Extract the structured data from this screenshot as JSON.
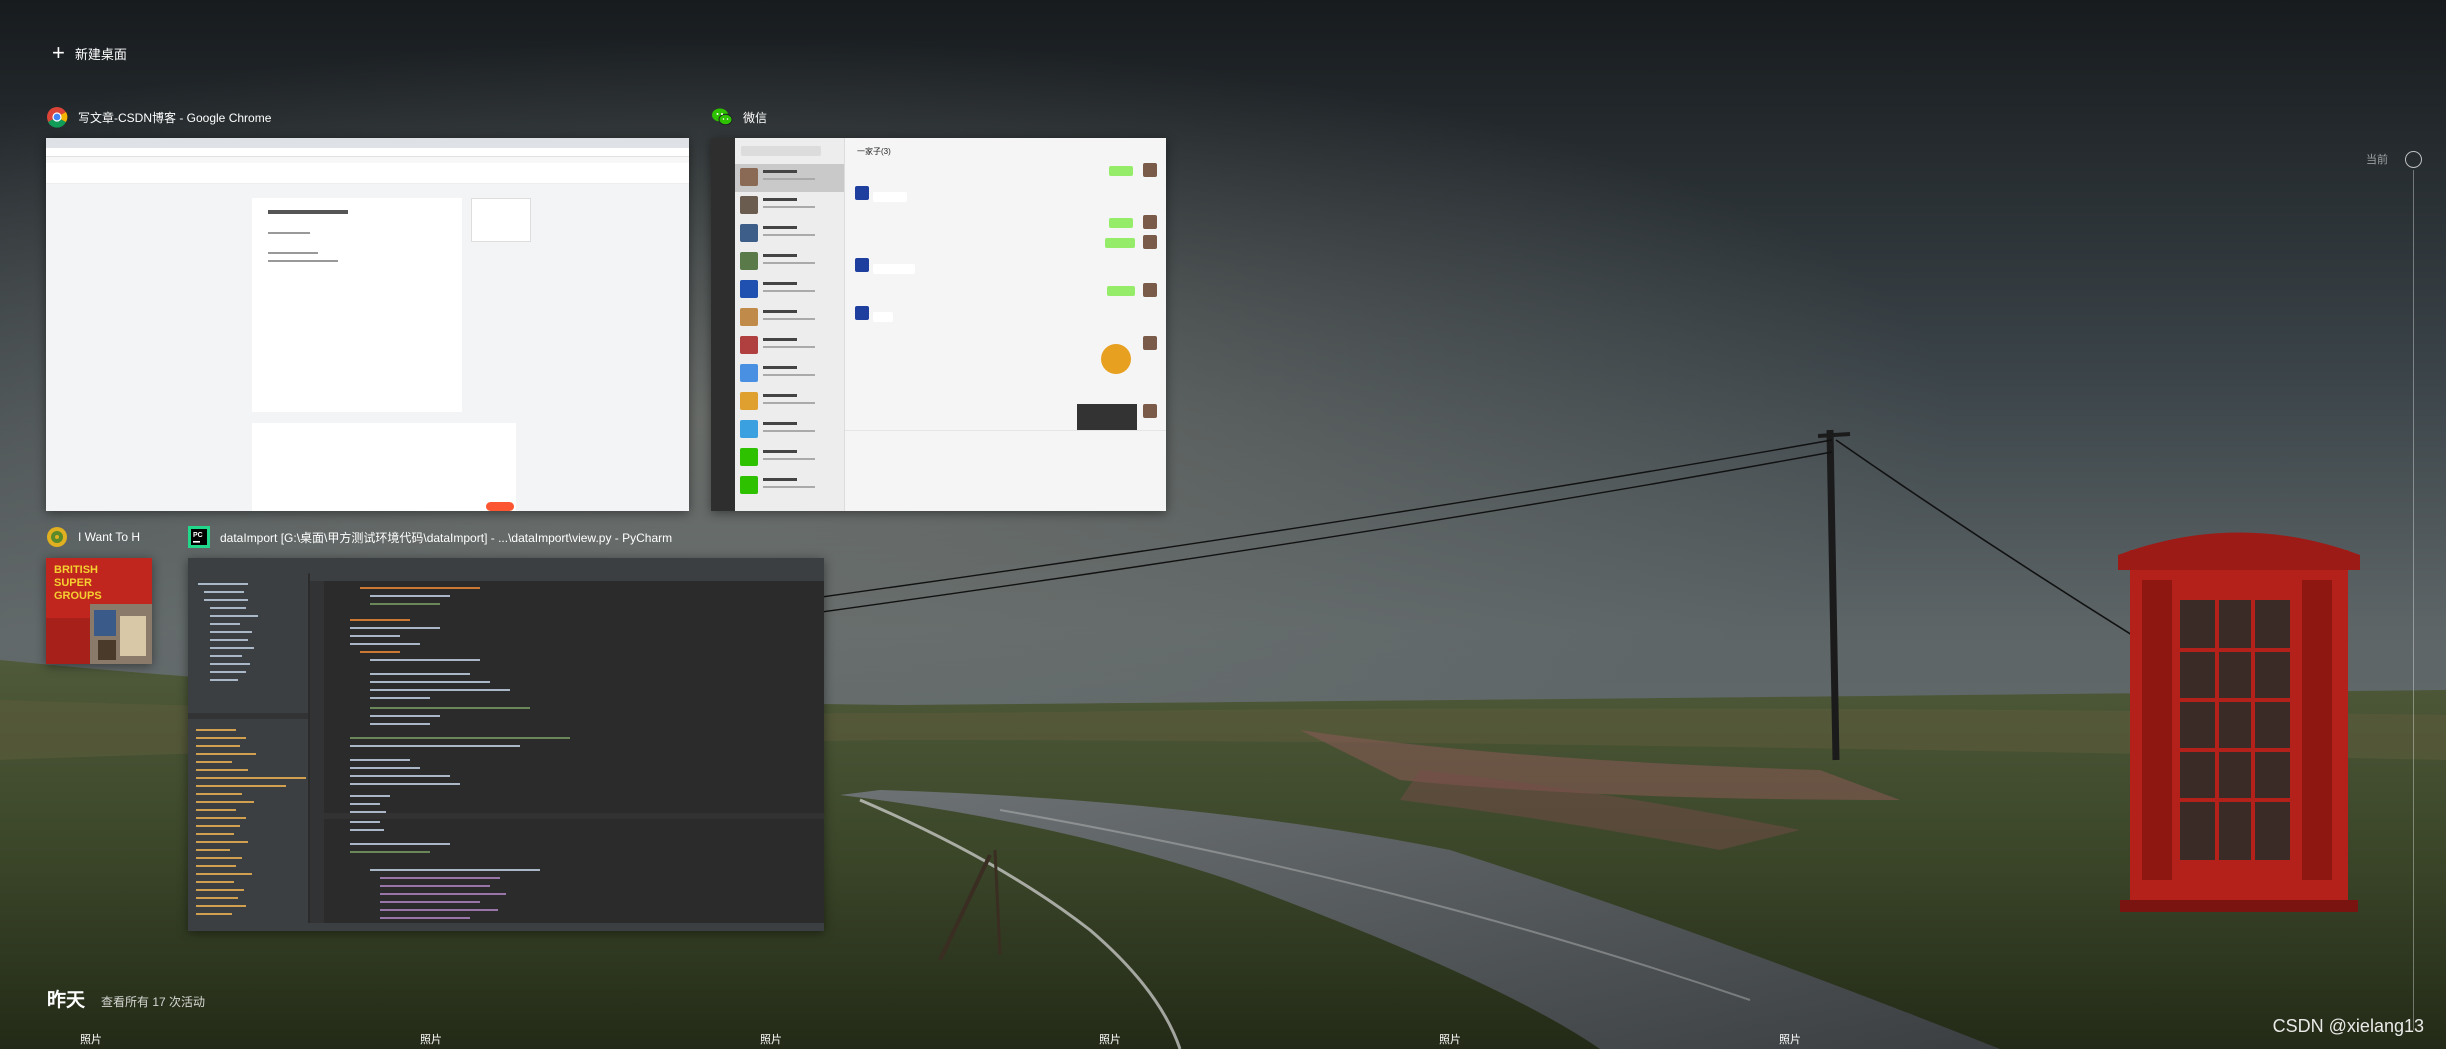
{
  "new_desktop": {
    "icon": "plus-icon",
    "label": "新建桌面"
  },
  "windows": [
    {
      "app": "Google Chrome",
      "icon": "chrome-icon",
      "title": "写文章-CSDN博客 - Google Chrome"
    },
    {
      "app": "微信",
      "icon": "wechat-icon",
      "title": "微信"
    },
    {
      "app": "Music",
      "icon": "music-icon",
      "title": "I Want To H"
    },
    {
      "app": "PyCharm",
      "icon": "pycharm-icon",
      "title": "dataImport [G:\\桌面\\甲方测试环境代码\\dataImport] - ...\\dataImport\\view.py - PyCharm"
    }
  ],
  "wechat_preview": {
    "chat_title": "一家子(3)"
  },
  "album_cover": {
    "line1": "BRITISH",
    "line2": "SUPER",
    "line3": "GROUPS"
  },
  "timeline": {
    "current_label": "当前"
  },
  "activity": {
    "day": "昨天",
    "see_all": "查看所有 17 次活动",
    "items": [
      "照片",
      "照片",
      "照片",
      "照片",
      "照片",
      "照片"
    ]
  },
  "watermark": "CSDN @xielang13",
  "colors": {
    "chrome_accent": "#fc5531",
    "wechat_green": "#95ec69",
    "pycharm_bg": "#2b2b2b",
    "phone_box_red": "#b4201a"
  }
}
